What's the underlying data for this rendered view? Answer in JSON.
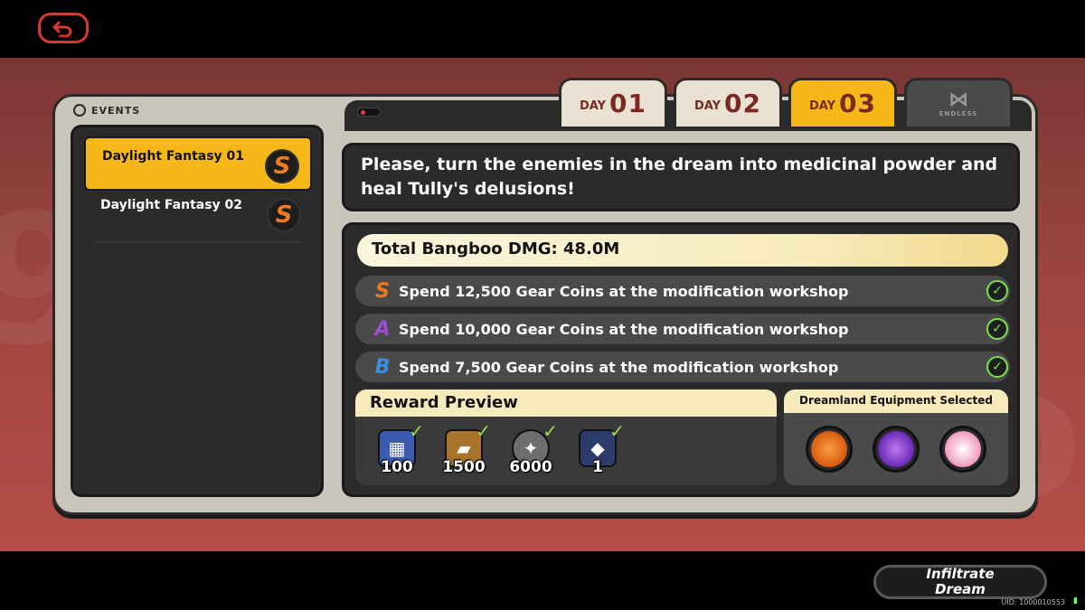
{
  "header": {
    "back_icon": "back-arrow-icon"
  },
  "frame": {
    "title": "EVENTS"
  },
  "tabs": [
    {
      "prefix": "DAY",
      "num": "01",
      "state": "default"
    },
    {
      "prefix": "DAY",
      "num": "02",
      "state": "default"
    },
    {
      "prefix": "DAY",
      "num": "03",
      "state": "active"
    },
    {
      "label": "ENDLESS",
      "icon": "endless-icon",
      "state": "locked"
    }
  ],
  "stages": [
    {
      "label": "Daylight Fantasy 01",
      "rank": "S",
      "selected": true
    },
    {
      "label": "Daylight Fantasy 02",
      "rank": "S",
      "selected": false
    }
  ],
  "description": "Please, turn the enemies in the dream into medicinal powder and heal Tully's delusions!",
  "mission": {
    "total": "Total Bangboo DMG: 48.0M",
    "conditions": [
      {
        "rank": "S",
        "color": "#f07a20",
        "text": "Spend 12,500 Gear Coins at the modification workshop"
      },
      {
        "rank": "A",
        "color": "#a24ad8",
        "text": "Spend 10,000 Gear Coins at the modification workshop"
      },
      {
        "rank": "B",
        "color": "#3a8ee0",
        "text": "Spend 7,500 Gear Coins at the modification workshop"
      }
    ]
  },
  "rewards": {
    "title": "Reward Preview",
    "items": [
      {
        "icon": "polychrome-icon",
        "qty": "100"
      },
      {
        "icon": "material-icon",
        "qty": "1500"
      },
      {
        "icon": "dennies-coin-icon",
        "qty": "6000"
      },
      {
        "icon": "chip-icon",
        "qty": "1"
      }
    ]
  },
  "equipment": {
    "title": "Dreamland Equipment Selected",
    "items": [
      {
        "icon": "equipment-orange-icon",
        "color": "#e26a18"
      },
      {
        "icon": "equipment-purple-icon",
        "color": "#8a3ad0"
      },
      {
        "icon": "equipment-pink-icon",
        "color": "#f4a8c8"
      }
    ]
  },
  "action": {
    "infiltrate": "Infiltrate Dream"
  },
  "footer": {
    "uid": "UID: 1000010553"
  }
}
